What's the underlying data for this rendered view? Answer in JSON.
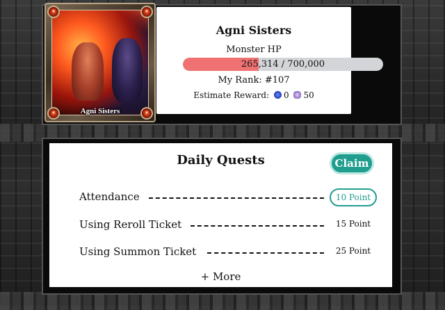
{
  "boss": {
    "portrait_name": "Agni Sisters",
    "name": "Agni Sisters",
    "hp_label": "Monster HP",
    "hp_current": 265314,
    "hp_max": 700000,
    "hp_fraction": 0.379,
    "hp_text": "265,314 / 700,000",
    "rank_text": "My Rank: #107",
    "reward_label": "Estimate Reward:",
    "reward_coin_value": "0",
    "reward_gem_value": "50"
  },
  "quests": {
    "title": "Daily Quests",
    "claim_label": "Claim",
    "items": [
      {
        "label": "Attendance",
        "points": "10 Point",
        "claimable": true
      },
      {
        "label": "Using Reroll Ticket",
        "points": "15 Point",
        "claimable": false
      },
      {
        "label": "Using Summon Ticket",
        "points": "25 Point",
        "claimable": false
      }
    ],
    "more_label": "+ More"
  },
  "colors": {
    "hp_bar": "#f07171",
    "hp_track": "#d3d5d8",
    "accent": "#1f9e8f"
  },
  "icons": {
    "coin": "blue-coin-icon",
    "gem": "gem-icon",
    "flame": "flame-icon"
  }
}
